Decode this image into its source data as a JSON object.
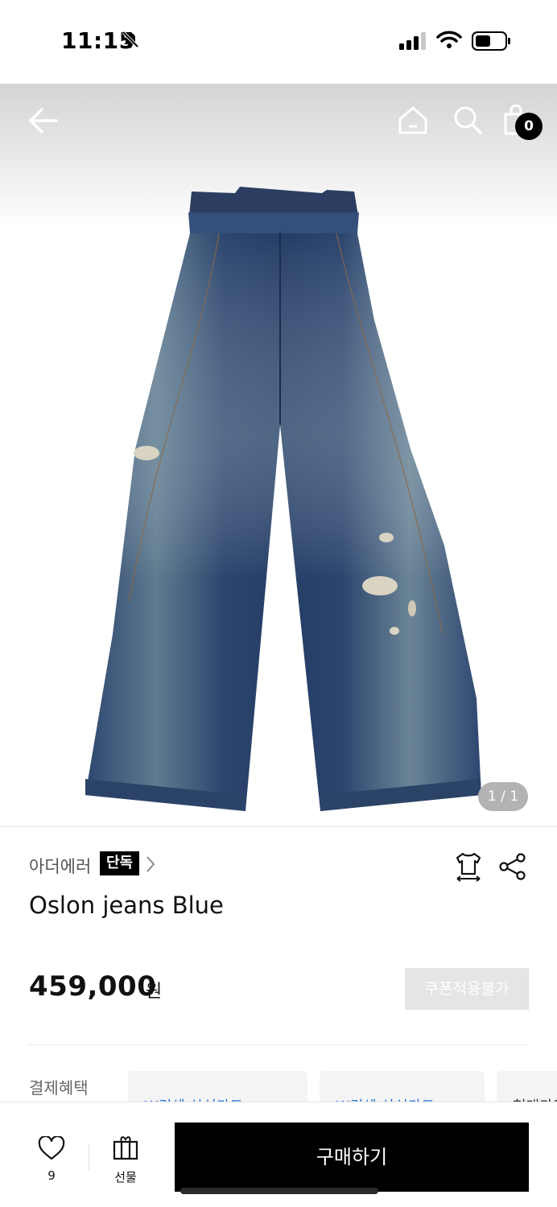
{
  "status_bar": {
    "time": "11:15"
  },
  "header": {
    "cart_count": "0"
  },
  "gallery": {
    "counter": "1 / 1"
  },
  "product": {
    "brand": "아더에러",
    "exclusive_badge": "단독",
    "title": "Oslon jeans Blue",
    "price": "459,000",
    "currency": "원",
    "coupon_label": "쿠폰적용불가"
  },
  "benefits": {
    "label": "결제혜택",
    "cards": [
      "W컨셉 삼성카드",
      "W컨셉 삼성카드",
      "현대카드"
    ]
  },
  "bottom_bar": {
    "like_count": "9",
    "gift_label": "선물",
    "buy_label": "구매하기"
  },
  "colors": {
    "accent_blue": "#2e79d6",
    "buy_bg": "#000000"
  }
}
